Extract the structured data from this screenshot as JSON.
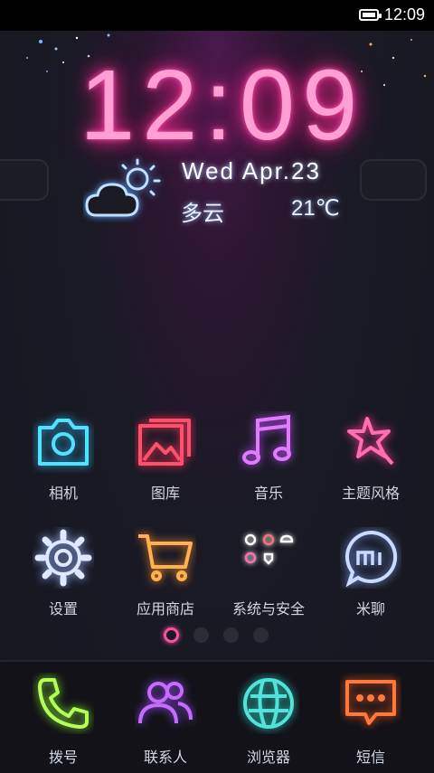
{
  "statusbar": {
    "time": "12:09",
    "icon": "battery-icon"
  },
  "lockclock": {
    "time": "12:09",
    "date": "Wed  Apr.23",
    "weather": "多云",
    "temperature": "21℃",
    "weather_icon": "partly-cloudy-icon"
  },
  "apps": [
    {
      "label": "相机",
      "icon": "camera-icon",
      "color": "#4fe3ff"
    },
    {
      "label": "图库",
      "icon": "gallery-icon",
      "color": "#ff4f6d"
    },
    {
      "label": "音乐",
      "icon": "music-icon",
      "color": "#e07bff"
    },
    {
      "label": "主题风格",
      "icon": "theme-star-icon",
      "color": "#ff6fb0"
    },
    {
      "label": "设置",
      "icon": "gear-icon",
      "color": "#dfe8ff"
    },
    {
      "label": "应用商店",
      "icon": "shopping-cart-icon",
      "color": "#ffb14f"
    },
    {
      "label": "系统与安全",
      "icon": "system-security-icon",
      "color": "#ffffff"
    },
    {
      "label": "米聊",
      "icon": "mi-chat-icon",
      "color": "#c9dbff"
    }
  ],
  "page_indicator": {
    "pages": 4,
    "active": 1
  },
  "dock": [
    {
      "label": "拨号",
      "icon": "phone-icon",
      "color": "#b4ff5a"
    },
    {
      "label": "联系人",
      "icon": "contacts-icon",
      "color": "#c66bff"
    },
    {
      "label": "浏览器",
      "icon": "browser-globe-icon",
      "color": "#4fe3d9"
    },
    {
      "label": "短信",
      "icon": "message-icon",
      "color": "#ff7a3a"
    }
  ]
}
